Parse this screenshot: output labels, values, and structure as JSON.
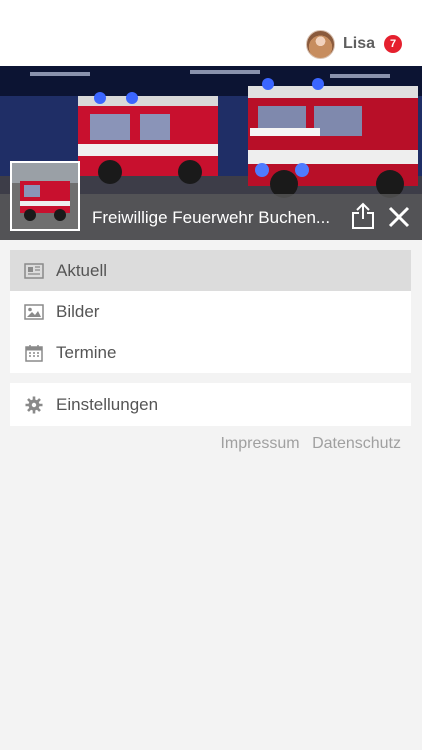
{
  "user": {
    "name": "Lisa",
    "notifications": "7"
  },
  "header": {
    "title": "Freiwillige Feuerwehr Buchen..."
  },
  "menu": {
    "items": [
      {
        "label": "Aktuell",
        "icon": "newspaper-icon",
        "active": true
      },
      {
        "label": "Bilder",
        "icon": "image-icon",
        "active": false
      },
      {
        "label": "Termine",
        "icon": "calendar-icon",
        "active": false
      }
    ],
    "settings": {
      "label": "Einstellungen",
      "icon": "gear-icon"
    }
  },
  "footer": {
    "impressum": "Impressum",
    "datenschutz": "Datenschutz"
  },
  "colors": {
    "badge": "#e5202e",
    "active_row": "#dcdcdc",
    "background": "#f3f3f3"
  }
}
